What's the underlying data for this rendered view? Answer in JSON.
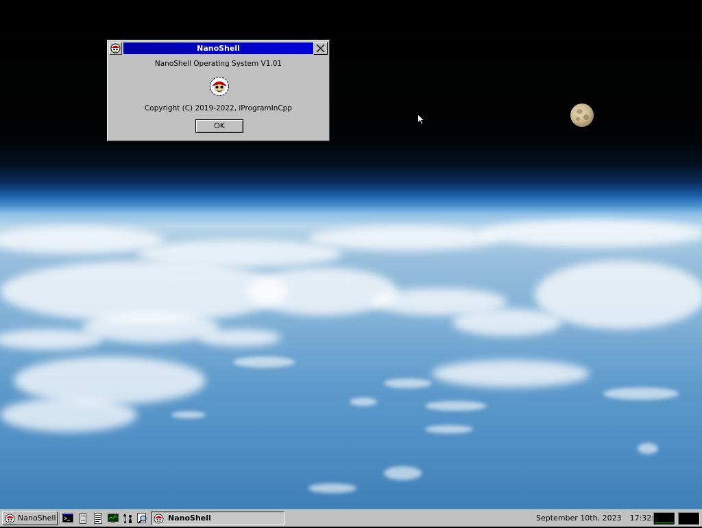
{
  "dialog": {
    "title": "NanoShell",
    "os_name": "NanoShell Operating System V1.01",
    "copyright": "Copyright (C) 2019-2022, iProgramInCpp",
    "ok_label": "OK"
  },
  "taskbar": {
    "start_label": "NanoShell",
    "quick_launch": [
      "terminal-icon",
      "file-cabinet-icon",
      "notepad-icon",
      "system-monitor-icon",
      "chess-icon",
      "magnifier-icon"
    ],
    "task_label": "NanoShell",
    "date": "September 10th, 2023",
    "time": "17:32:00"
  },
  "colors": {
    "titlebar": "#0000a8",
    "face": "#c0c0c0"
  }
}
